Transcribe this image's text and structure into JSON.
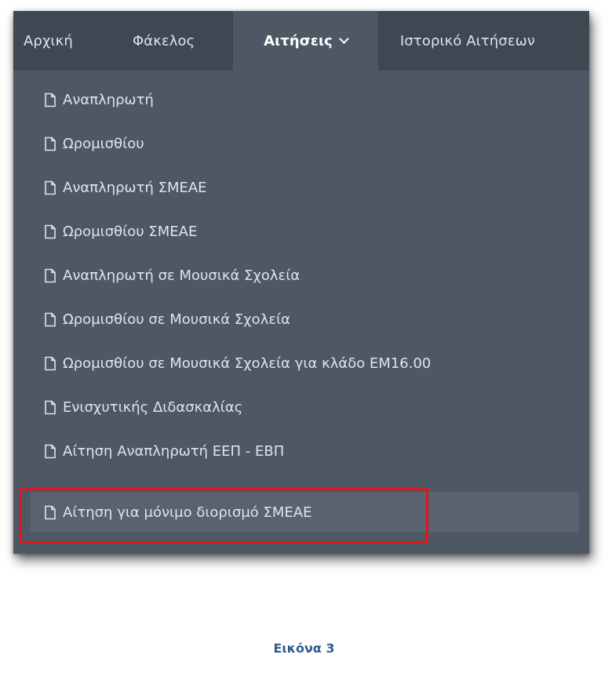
{
  "nav": {
    "items": [
      {
        "label": "Αρχική"
      },
      {
        "label": "Φάκελος"
      },
      {
        "label": "Αιτήσεις"
      },
      {
        "label": "Ιστορικό Αιτήσεων"
      }
    ],
    "active_index": 2,
    "active_icon": "chevron-down-icon"
  },
  "menu": {
    "item_icon": "document-icon",
    "items": [
      {
        "label": "Αναπληρωτή"
      },
      {
        "label": "Ωρομισθίου"
      },
      {
        "label": "Αναπληρωτή ΣΜΕΑΕ"
      },
      {
        "label": "Ωρομισθίου ΣΜΕΑΕ"
      },
      {
        "label": "Αναπληρωτή σε Μουσικά Σχολεία"
      },
      {
        "label": "Ωρομισθίου σε Μουσικά Σχολεία"
      },
      {
        "label": "Ωρομισθίου σε Μουσικά Σχολεία για κλάδο ΕΜ16.00"
      },
      {
        "label": "Ενισχυτικής Διδασκαλίας"
      },
      {
        "label": "Αίτηση Αναπληρωτή ΕΕΠ - ΕΒΠ"
      },
      {
        "label": "Αίτηση για μόνιμο διορισμό ΣΜΕΑΕ"
      }
    ],
    "highlighted_index": 9
  },
  "colors": {
    "nav_background": "#3d4853",
    "menu_background": "#4d5864",
    "highlight_background": "#58636f",
    "annotation_red": "#e3141c",
    "caption_blue": "#2f5b8f"
  },
  "caption": "Εικόνα 3"
}
